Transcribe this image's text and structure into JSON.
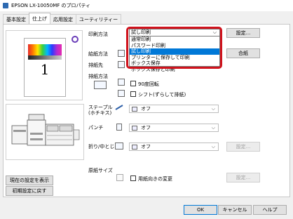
{
  "window": {
    "title": "EPSON LX-10050MF のプロパティ"
  },
  "tabs": [
    "基本設定",
    "仕上げ",
    "応用設定",
    "ユーティリティー"
  ],
  "print_method": {
    "label": "印刷方法",
    "selected": "試し印刷",
    "options": [
      "通常印刷",
      "パスワード印刷",
      "試し印刷",
      "プリンターに保存して印刷",
      "ボックス保存",
      "ボックス保存と印刷"
    ],
    "settings_button": "設定..."
  },
  "paper_feed": {
    "label": "給紙方法",
    "button": "合紙"
  },
  "output": {
    "label": "排紙先"
  },
  "output_method": {
    "label": "排紙方法",
    "rotate_90": "90度回転",
    "shift": "シフト(ずらして排紙)"
  },
  "staple": {
    "label_line1": "ステープル",
    "label_line2": "(ホチキス)",
    "value": "オフ"
  },
  "punch": {
    "label": "パンチ",
    "value": "オフ"
  },
  "fold": {
    "label": "折り/中とじ",
    "value": "オフ",
    "settings_button": "設定..."
  },
  "output_size": {
    "label": "原紙サイズ",
    "checkbox": "用紙向きの変更",
    "settings_button": "設定..."
  },
  "side_buttons": {
    "show_current": "現在の設定を表示",
    "reset": "初期設定に戻す"
  },
  "preview": {
    "page_number": "1"
  },
  "footer": {
    "ok": "OK",
    "cancel": "キャンセル",
    "help": "ヘルプ"
  }
}
